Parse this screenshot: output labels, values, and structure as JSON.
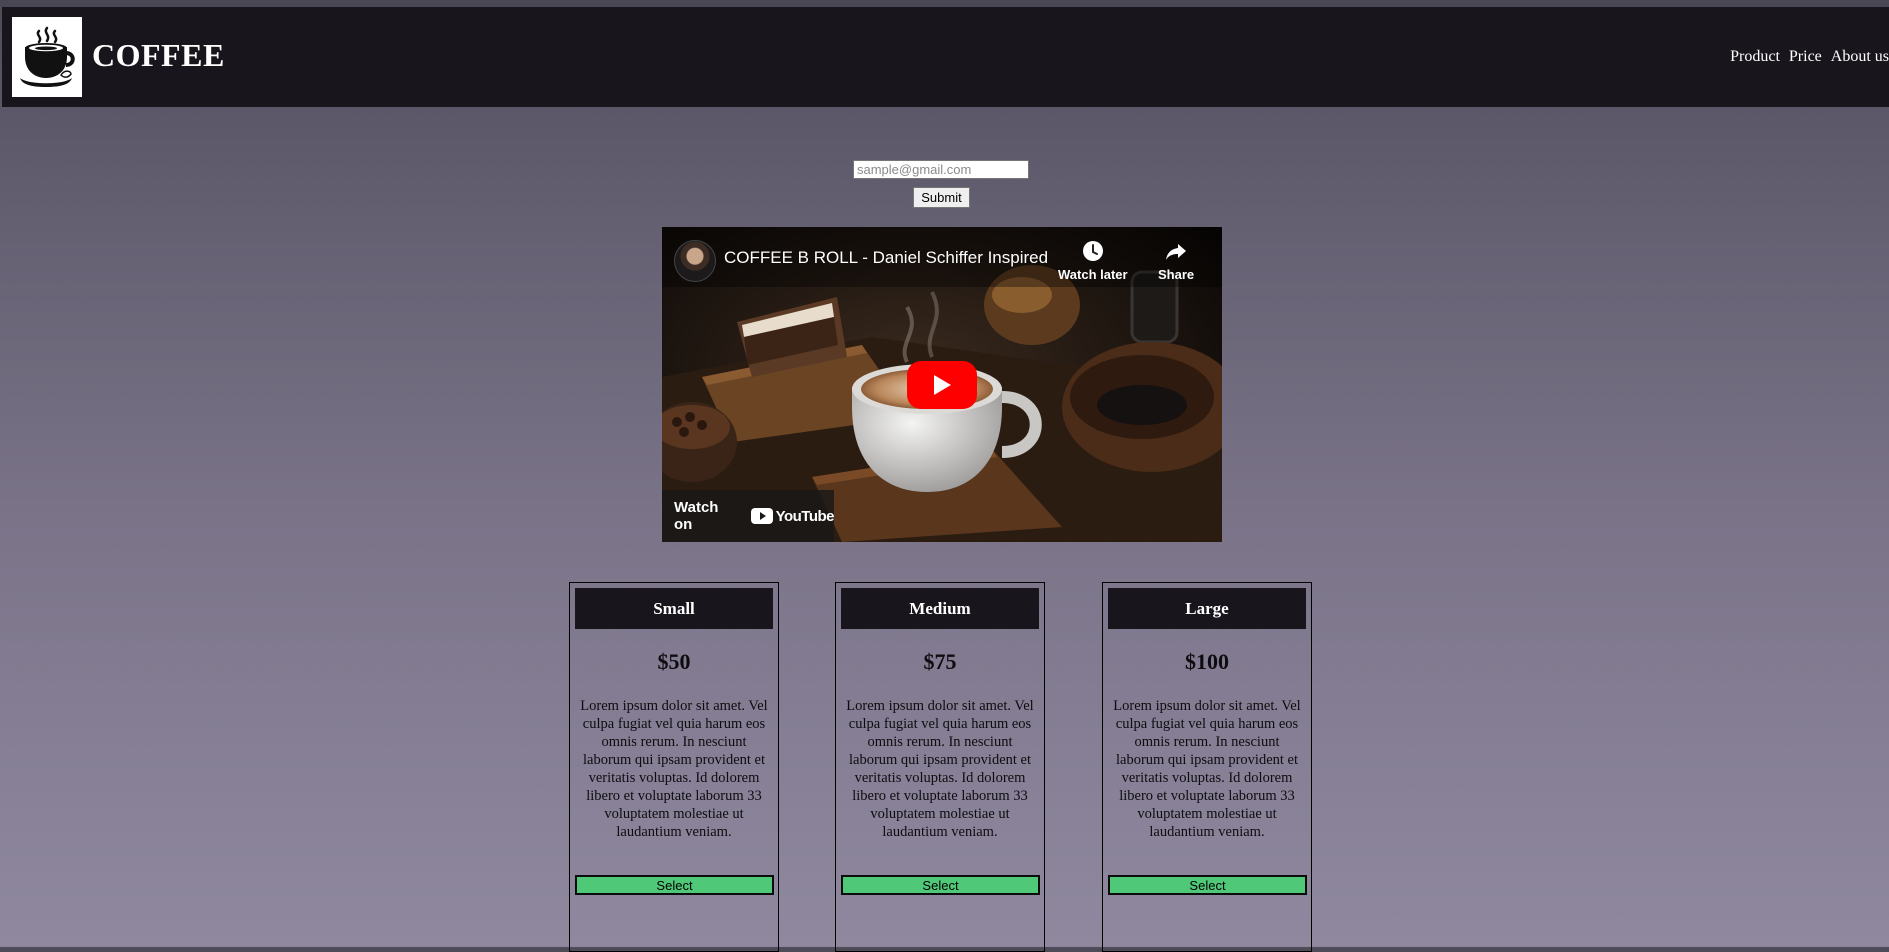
{
  "header": {
    "brand": "COFFEE",
    "logo_icon": "coffee-cup-icon",
    "nav": [
      {
        "label": "Product"
      },
      {
        "label": "Price"
      },
      {
        "label": "About us"
      }
    ]
  },
  "signup": {
    "email_placeholder": "sample@gmail.com",
    "submit_label": "Submit"
  },
  "video": {
    "title": "COFFEE B ROLL - Daniel Schiffer Inspired",
    "watch_later_label": "Watch later",
    "share_label": "Share",
    "watch_on_label": "Watch on",
    "platform_label": "YouTube",
    "play_icon": "play-icon"
  },
  "pricing": {
    "plans": [
      {
        "name": "Small",
        "price": "$50",
        "description": "Lorem ipsum dolor sit amet. Vel culpa fugiat vel quia harum eos omnis rerum. In nesciunt laborum qui ipsam provident et veritatis voluptas. Id dolorem libero et voluptate laborum 33 voluptatem molestiae ut laudantium veniam.",
        "button_label": "Select"
      },
      {
        "name": "Medium",
        "price": "$75",
        "description": "Lorem ipsum dolor sit amet. Vel culpa fugiat vel quia harum eos omnis rerum. In nesciunt laborum qui ipsam provident et veritatis voluptas. Id dolorem libero et voluptate laborum 33 voluptatem molestiae ut laudantium veniam.",
        "button_label": "Select"
      },
      {
        "name": "Large",
        "price": "$100",
        "description": "Lorem ipsum dolor sit amet. Vel culpa fugiat vel quia harum eos omnis rerum. In nesciunt laborum qui ipsam provident et veritatis voluptas. Id dolorem libero et voluptate laborum 33 voluptatem molestiae ut laudantium veniam.",
        "button_label": "Select"
      }
    ]
  },
  "colors": {
    "navbar_bg": "#18161c",
    "select_button": "#4fc878",
    "play_button": "#ff0000"
  }
}
